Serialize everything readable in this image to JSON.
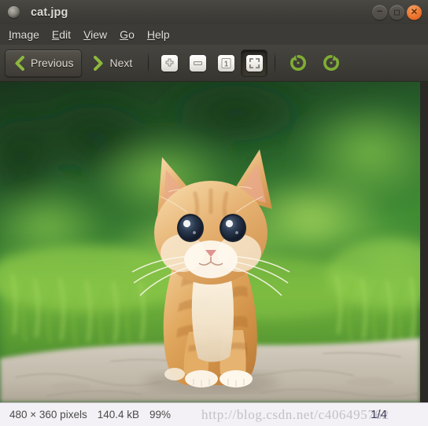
{
  "window": {
    "title": "cat.jpg",
    "app_icon": "image-document-icon",
    "controls": [
      {
        "name": "minimize-button",
        "glyph": "−"
      },
      {
        "name": "maximize-button",
        "glyph": "□"
      },
      {
        "name": "close-button",
        "glyph": "✕"
      }
    ]
  },
  "menubar": {
    "items": [
      {
        "mnemonic": "I",
        "rest": "mage",
        "label": "Image"
      },
      {
        "mnemonic": "E",
        "rest": "dit",
        "label": "Edit"
      },
      {
        "mnemonic": "V",
        "rest": "iew",
        "label": "View"
      },
      {
        "mnemonic": "G",
        "rest": "o",
        "label": "Go"
      },
      {
        "mnemonic": "H",
        "rest": "elp",
        "label": "Help"
      }
    ]
  },
  "toolbar": {
    "previous_label": "Previous",
    "next_label": "Next",
    "previous_icon": "chevron-left-icon",
    "next_icon": "chevron-right-icon",
    "zoom_in_icon": "zoom-in-icon",
    "zoom_out_icon": "zoom-out-icon",
    "normal_size_icon": "normal-size-icon",
    "normal_size_glyph": "1",
    "best_fit_icon": "best-fit-icon",
    "rotate_ccw_icon": "rotate-counterclockwise-icon",
    "rotate_cw_icon": "rotate-clockwise-icon",
    "best_fit_active": true,
    "previous_hover": true,
    "accent_green": "#8cb83c",
    "accent_orange": "#ef7a32"
  },
  "image": {
    "alt": "orange tabby kitten standing on stone with green grass background",
    "subject": "kitten",
    "background": "blurred green foliage and grass",
    "foreground": "light gray stone ledge"
  },
  "statusbar": {
    "dimensions": "480 × 360 pixels",
    "filesize": "140.4 kB",
    "zoom": "99%",
    "page": "1/4",
    "watermark": "http://blog.csdn.net/c406495762"
  }
}
